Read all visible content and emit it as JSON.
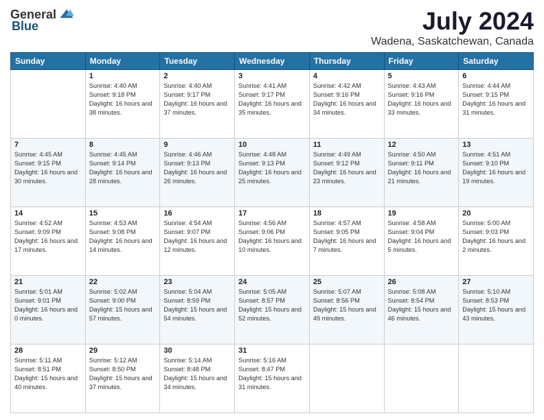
{
  "logo": {
    "general": "General",
    "blue": "Blue"
  },
  "title": "July 2024",
  "location": "Wadena, Saskatchewan, Canada",
  "days_of_week": [
    "Sunday",
    "Monday",
    "Tuesday",
    "Wednesday",
    "Thursday",
    "Friday",
    "Saturday"
  ],
  "weeks": [
    [
      {
        "day": "",
        "sunrise": "",
        "sunset": "",
        "daylight": ""
      },
      {
        "day": "1",
        "sunrise": "Sunrise: 4:40 AM",
        "sunset": "Sunset: 9:18 PM",
        "daylight": "Daylight: 16 hours and 38 minutes."
      },
      {
        "day": "2",
        "sunrise": "Sunrise: 4:40 AM",
        "sunset": "Sunset: 9:17 PM",
        "daylight": "Daylight: 16 hours and 37 minutes."
      },
      {
        "day": "3",
        "sunrise": "Sunrise: 4:41 AM",
        "sunset": "Sunset: 9:17 PM",
        "daylight": "Daylight: 16 hours and 35 minutes."
      },
      {
        "day": "4",
        "sunrise": "Sunrise: 4:42 AM",
        "sunset": "Sunset: 9:16 PM",
        "daylight": "Daylight: 16 hours and 34 minutes."
      },
      {
        "day": "5",
        "sunrise": "Sunrise: 4:43 AM",
        "sunset": "Sunset: 9:16 PM",
        "daylight": "Daylight: 16 hours and 33 minutes."
      },
      {
        "day": "6",
        "sunrise": "Sunrise: 4:44 AM",
        "sunset": "Sunset: 9:15 PM",
        "daylight": "Daylight: 16 hours and 31 minutes."
      }
    ],
    [
      {
        "day": "7",
        "sunrise": "Sunrise: 4:45 AM",
        "sunset": "Sunset: 9:15 PM",
        "daylight": "Daylight: 16 hours and 30 minutes."
      },
      {
        "day": "8",
        "sunrise": "Sunrise: 4:45 AM",
        "sunset": "Sunset: 9:14 PM",
        "daylight": "Daylight: 16 hours and 28 minutes."
      },
      {
        "day": "9",
        "sunrise": "Sunrise: 4:46 AM",
        "sunset": "Sunset: 9:13 PM",
        "daylight": "Daylight: 16 hours and 26 minutes."
      },
      {
        "day": "10",
        "sunrise": "Sunrise: 4:48 AM",
        "sunset": "Sunset: 9:13 PM",
        "daylight": "Daylight: 16 hours and 25 minutes."
      },
      {
        "day": "11",
        "sunrise": "Sunrise: 4:49 AM",
        "sunset": "Sunset: 9:12 PM",
        "daylight": "Daylight: 16 hours and 23 minutes."
      },
      {
        "day": "12",
        "sunrise": "Sunrise: 4:50 AM",
        "sunset": "Sunset: 9:11 PM",
        "daylight": "Daylight: 16 hours and 21 minutes."
      },
      {
        "day": "13",
        "sunrise": "Sunrise: 4:51 AM",
        "sunset": "Sunset: 9:10 PM",
        "daylight": "Daylight: 16 hours and 19 minutes."
      }
    ],
    [
      {
        "day": "14",
        "sunrise": "Sunrise: 4:52 AM",
        "sunset": "Sunset: 9:09 PM",
        "daylight": "Daylight: 16 hours and 17 minutes."
      },
      {
        "day": "15",
        "sunrise": "Sunrise: 4:53 AM",
        "sunset": "Sunset: 9:08 PM",
        "daylight": "Daylight: 16 hours and 14 minutes."
      },
      {
        "day": "16",
        "sunrise": "Sunrise: 4:54 AM",
        "sunset": "Sunset: 9:07 PM",
        "daylight": "Daylight: 16 hours and 12 minutes."
      },
      {
        "day": "17",
        "sunrise": "Sunrise: 4:56 AM",
        "sunset": "Sunset: 9:06 PM",
        "daylight": "Daylight: 16 hours and 10 minutes."
      },
      {
        "day": "18",
        "sunrise": "Sunrise: 4:57 AM",
        "sunset": "Sunset: 9:05 PM",
        "daylight": "Daylight: 16 hours and 7 minutes."
      },
      {
        "day": "19",
        "sunrise": "Sunrise: 4:58 AM",
        "sunset": "Sunset: 9:04 PM",
        "daylight": "Daylight: 16 hours and 5 minutes."
      },
      {
        "day": "20",
        "sunrise": "Sunrise: 5:00 AM",
        "sunset": "Sunset: 9:03 PM",
        "daylight": "Daylight: 16 hours and 2 minutes."
      }
    ],
    [
      {
        "day": "21",
        "sunrise": "Sunrise: 5:01 AM",
        "sunset": "Sunset: 9:01 PM",
        "daylight": "Daylight: 16 hours and 0 minutes."
      },
      {
        "day": "22",
        "sunrise": "Sunrise: 5:02 AM",
        "sunset": "Sunset: 9:00 PM",
        "daylight": "Daylight: 15 hours and 57 minutes."
      },
      {
        "day": "23",
        "sunrise": "Sunrise: 5:04 AM",
        "sunset": "Sunset: 8:59 PM",
        "daylight": "Daylight: 15 hours and 54 minutes."
      },
      {
        "day": "24",
        "sunrise": "Sunrise: 5:05 AM",
        "sunset": "Sunset: 8:57 PM",
        "daylight": "Daylight: 15 hours and 52 minutes."
      },
      {
        "day": "25",
        "sunrise": "Sunrise: 5:07 AM",
        "sunset": "Sunset: 8:56 PM",
        "daylight": "Daylight: 15 hours and 49 minutes."
      },
      {
        "day": "26",
        "sunrise": "Sunrise: 5:08 AM",
        "sunset": "Sunset: 8:54 PM",
        "daylight": "Daylight: 15 hours and 46 minutes."
      },
      {
        "day": "27",
        "sunrise": "Sunrise: 5:10 AM",
        "sunset": "Sunset: 8:53 PM",
        "daylight": "Daylight: 15 hours and 43 minutes."
      }
    ],
    [
      {
        "day": "28",
        "sunrise": "Sunrise: 5:11 AM",
        "sunset": "Sunset: 8:51 PM",
        "daylight": "Daylight: 15 hours and 40 minutes."
      },
      {
        "day": "29",
        "sunrise": "Sunrise: 5:12 AM",
        "sunset": "Sunset: 8:50 PM",
        "daylight": "Daylight: 15 hours and 37 minutes."
      },
      {
        "day": "30",
        "sunrise": "Sunrise: 5:14 AM",
        "sunset": "Sunset: 8:48 PM",
        "daylight": "Daylight: 15 hours and 34 minutes."
      },
      {
        "day": "31",
        "sunrise": "Sunrise: 5:16 AM",
        "sunset": "Sunset: 8:47 PM",
        "daylight": "Daylight: 15 hours and 31 minutes."
      },
      {
        "day": "",
        "sunrise": "",
        "sunset": "",
        "daylight": ""
      },
      {
        "day": "",
        "sunrise": "",
        "sunset": "",
        "daylight": ""
      },
      {
        "day": "",
        "sunrise": "",
        "sunset": "",
        "daylight": ""
      }
    ]
  ]
}
